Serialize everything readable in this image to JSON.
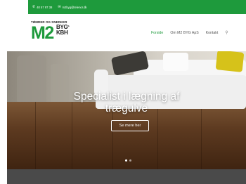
{
  "topbar": {
    "phone_icon": "phone-icon",
    "phone": "40 57 97 38",
    "email_icon": "mail-icon",
    "email": "m2byg@telenor.dk"
  },
  "logo": {
    "tagline": "TØMRER OG SNEDKER",
    "m2": "M2",
    "line1": "BYG",
    "line2": "KBH",
    "suffix": ".dk"
  },
  "nav": {
    "items": [
      "Forside",
      "Om M2 BYG ApS",
      "Kontakt"
    ],
    "active_index": 0,
    "search_icon": "search-icon"
  },
  "hero": {
    "title_line1": "Specialist i lægning af",
    "title_line2": "trægulve",
    "cta_label": "Se mere her",
    "slides_total": 2,
    "active_slide": 1
  },
  "colors": {
    "brand_green": "#1e9a3c",
    "footer_band": "#4a4a4a"
  }
}
